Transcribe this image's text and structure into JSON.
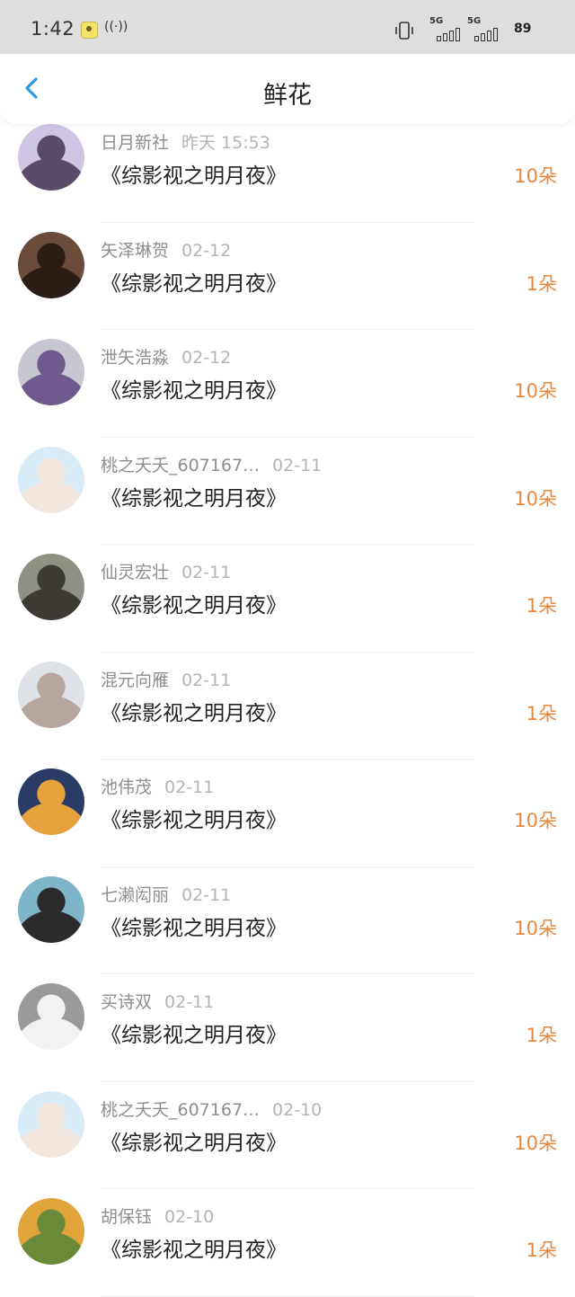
{
  "status": {
    "time": "1:42",
    "net1": "5G",
    "net2": "5G",
    "battery": "89"
  },
  "header": {
    "title": "鲜花"
  },
  "icons": {
    "back": "chevron-left-icon"
  },
  "colors": {
    "accent": "#2a9ae3",
    "count": "#e8883d"
  },
  "items": [
    {
      "name": "日月新社",
      "date": "昨天 15:53",
      "book": "《综影视之明月夜》",
      "count": "10朵",
      "avatar": [
        "#cfc6e6",
        "#5a4a6a"
      ]
    },
    {
      "name": "矢泽琳贺",
      "date": "02-12",
      "book": "《综影视之明月夜》",
      "count": "1朵",
      "avatar": [
        "#6b4b3a",
        "#2b1d16"
      ]
    },
    {
      "name": "泄矢浩淼",
      "date": "02-12",
      "book": "《综影视之明月夜》",
      "count": "10朵",
      "avatar": [
        "#c6c7d0",
        "#6e5a8c"
      ]
    },
    {
      "name": "桃之夭夭_607167…",
      "date": "02-11",
      "book": "《综影视之明月夜》",
      "count": "10朵",
      "avatar": [
        "#d8ecf7",
        "#f2e7df"
      ]
    },
    {
      "name": "仙灵宏壮",
      "date": "02-11",
      "book": "《综影视之明月夜》",
      "count": "1朵",
      "avatar": [
        "#8f9184",
        "#3c3a33"
      ]
    },
    {
      "name": "混元向雁",
      "date": "02-11",
      "book": "《综影视之明月夜》",
      "count": "1朵",
      "avatar": [
        "#dfe2e6",
        "#b7a5a0"
      ]
    },
    {
      "name": "池伟茂",
      "date": "02-11",
      "book": "《综影视之明月夜》",
      "count": "10朵",
      "avatar": [
        "#2a3b66",
        "#e6a23c"
      ]
    },
    {
      "name": "七濑闳丽",
      "date": "02-11",
      "book": "《综影视之明月夜》",
      "count": "10朵",
      "avatar": [
        "#7fb5c9",
        "#2b2b2b"
      ]
    },
    {
      "name": "买诗双",
      "date": "02-11",
      "book": "《综影视之明月夜》",
      "count": "1朵",
      "avatar": [
        "#9a9a9a",
        "#f2f2f2"
      ]
    },
    {
      "name": "桃之夭夭_607167…",
      "date": "02-10",
      "book": "《综影视之明月夜》",
      "count": "10朵",
      "avatar": [
        "#d8ecf7",
        "#f2e7df"
      ]
    },
    {
      "name": "胡保钰",
      "date": "02-10",
      "book": "《综影视之明月夜》",
      "count": "1朵",
      "avatar": [
        "#e0a43b",
        "#6a8a3a"
      ]
    }
  ]
}
